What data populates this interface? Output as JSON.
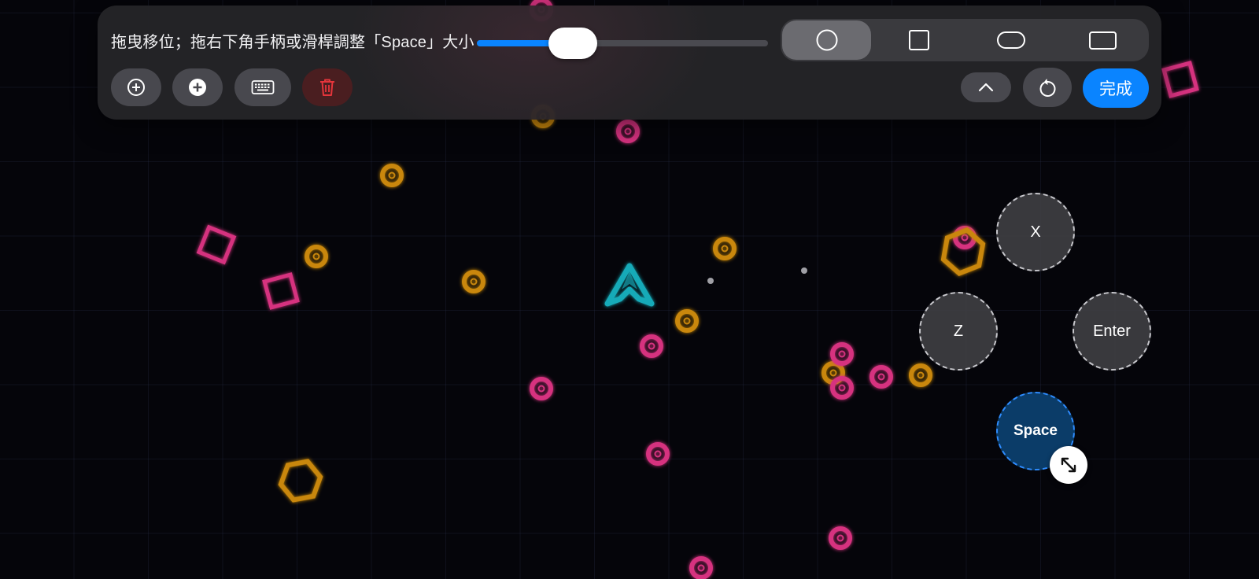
{
  "toolbar": {
    "hint": "拖曳移位；拖右下角手柄或滑桿調整「Space」大小",
    "size_slider_fraction": 0.33,
    "shape_options": [
      {
        "name": "circle",
        "selected": true
      },
      {
        "name": "square",
        "selected": false
      },
      {
        "name": "rounded-rectangle",
        "selected": false
      },
      {
        "name": "rectangle",
        "selected": false
      }
    ],
    "done_label": "完成",
    "actions": [
      "add-circle-outline-icon",
      "add-circle-filled-icon",
      "keyboard-icon",
      "trash-icon",
      "chevron-up-icon",
      "reset-icon"
    ]
  },
  "virtual_keys": [
    {
      "label": "X"
    },
    {
      "label": "Z"
    },
    {
      "label": "Enter"
    },
    {
      "label": "Space",
      "selected": true
    }
  ],
  "colors": {
    "accent_blue": "#0a84ff",
    "enemy_pink": "#d6317f",
    "coin_gold": "#c9870b",
    "player_cyan": "#17aab8",
    "danger_red": "#e5353b"
  }
}
